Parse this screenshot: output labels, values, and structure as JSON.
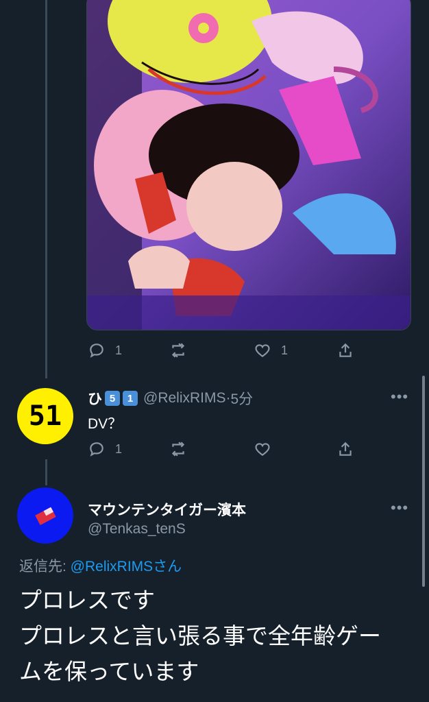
{
  "tweet1": {
    "reply_count": "1",
    "like_count": "1"
  },
  "tweet2": {
    "display_name": "ひ",
    "badges": [
      "5",
      "1"
    ],
    "handle": "@RelixRIMS",
    "separator": "·",
    "time": "5分",
    "text": "DV？",
    "reply_count": "1",
    "avatar_text": "51"
  },
  "tweet3": {
    "display_name": "マウンテンタイガー濱本",
    "handle": "@Tenkas_tenS",
    "reply_prefix": "返信先: ",
    "reply_handle": "@RelixRIMS",
    "reply_suffix": "さん",
    "lines": [
      "プロレスです",
      "プロレスと言い張る事で全年齢ゲー",
      "ムを保っています"
    ]
  },
  "more_label": "•••",
  "colors": {
    "background": "#15202b",
    "muted": "#8b98a5",
    "link": "#1d9bf0",
    "avatar2_bg": "#ffef00",
    "avatar3_bg": "#0a1af0"
  }
}
